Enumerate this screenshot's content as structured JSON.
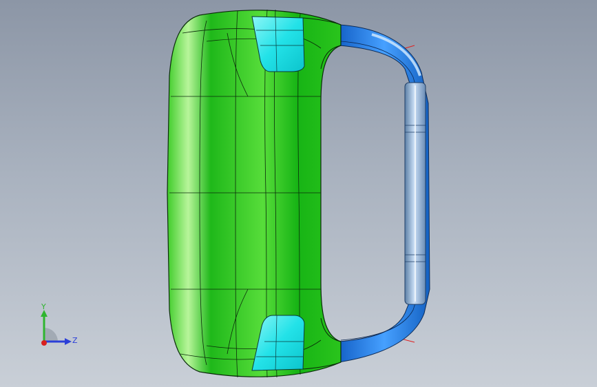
{
  "triad": {
    "y_label": "Y",
    "z_label": "Z",
    "colors": {
      "y": "#2fb52f",
      "z": "#2b3fd8",
      "x": "#d82020"
    }
  },
  "model": {
    "colors": {
      "body": "#22c41a",
      "body_light": "#9af07a",
      "face_cyan": "#22e8e8",
      "handle_blue": "#1a7ef0",
      "handle_light": "#9fc4ea",
      "edge": "#0a2a0a"
    }
  }
}
